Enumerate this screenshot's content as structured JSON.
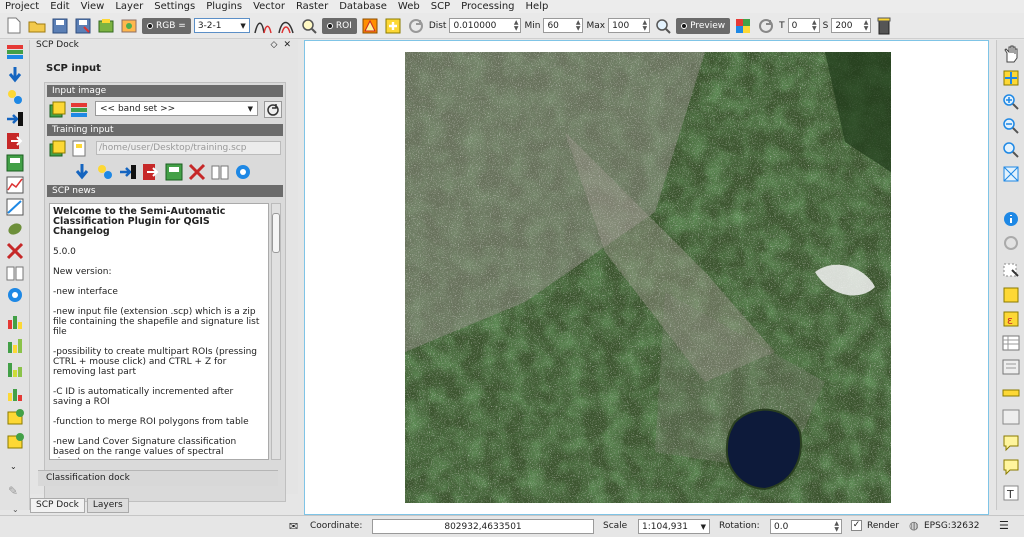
{
  "menu": [
    "Project",
    "Edit",
    "View",
    "Layer",
    "Settings",
    "Plugins",
    "Vector",
    "Raster",
    "Database",
    "Web",
    "SCP",
    "Processing",
    "Help"
  ],
  "toolbar": {
    "rgb_label": "RGB =",
    "rgb_value": "3-2-1",
    "roi_label": "ROI",
    "dist_label": "Dist",
    "dist_value": "0.010000",
    "min_label": "Min",
    "min_value": "60",
    "max_label": "Max",
    "max_value": "100",
    "preview_label": "Preview",
    "t_label": "T",
    "t_value": "0",
    "s_label": "S",
    "s_value": "200"
  },
  "dock": {
    "title": "SCP Dock",
    "float_glyph": "◇",
    "close_glyph": "✕",
    "panel_title": "SCP input",
    "input_image_header": "Input image",
    "band_set_value": "<< band set >>",
    "training_input_header": "Training input",
    "training_path": "/home/user/Desktop/training.scp",
    "news_header": "SCP news",
    "news": {
      "title": "Welcome to the Semi-Automatic Classification Plugin for QGIS Changelog",
      "version": "5.0.0",
      "items": [
        "New version:",
        "-new interface",
        "-new input file (extension .scp) which is a zip file containing the shapefile and signature list file",
        "-possibility to create multipart ROIs (pressing CTRL + mouse click) and CTRL + Z for removing last part",
        "-C ID is automatically incremented after saving a ROI",
        "-function to merge ROI polygons from table",
        "-new Land Cover Signature classification based on the range values of spectral signatures"
      ]
    },
    "classification_dock_tab": "Classification dock"
  },
  "bottom_tabs": [
    "SCP Dock",
    "Layers"
  ],
  "status": {
    "coordinate_label": "Coordinate:",
    "coordinate_value": "802932,4633501",
    "scale_label": "Scale",
    "scale_value": "1:104,931",
    "rotation_label": "Rotation:",
    "rotation_value": "0.0",
    "render_label": "Render",
    "crs": "EPSG:32632"
  }
}
